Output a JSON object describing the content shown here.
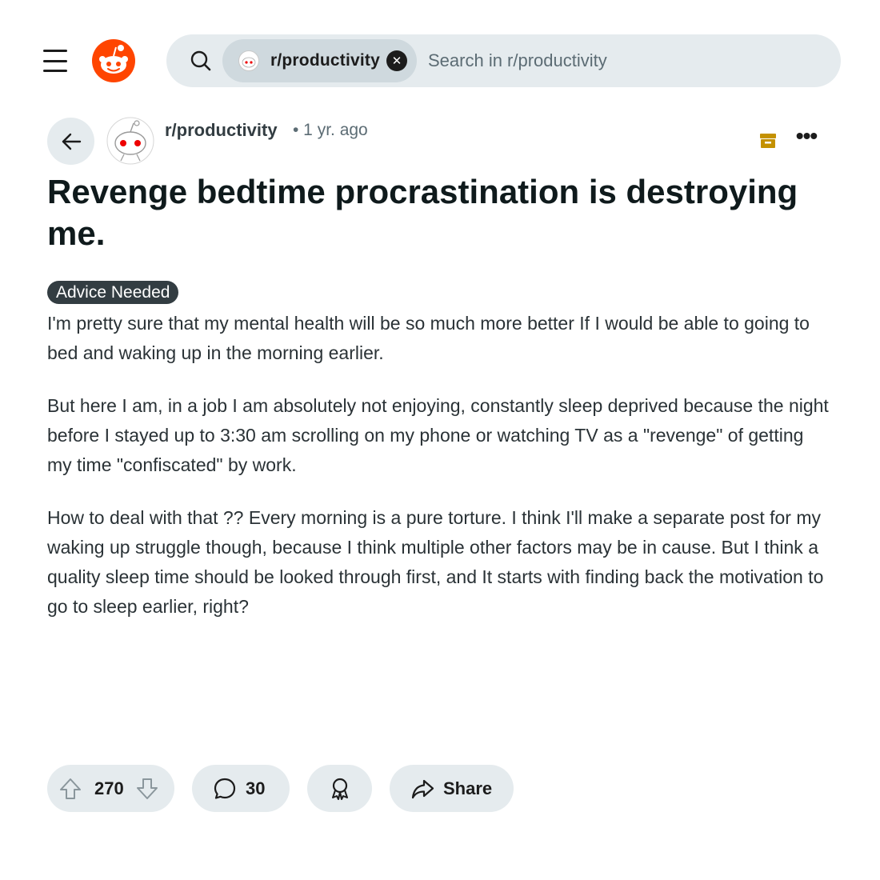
{
  "header": {
    "search": {
      "community_chip": "r/productivity",
      "placeholder": "Search in r/productivity"
    }
  },
  "post": {
    "subreddit": "r/productivity",
    "time": "• 1 yr. ago",
    "title": "Revenge bedtime procrastination is destroying me.",
    "flair": "Advice Needed",
    "body": [
      "I'm pretty sure that my mental health will be so much more better If I would be able to going to bed and waking up in the morning earlier.",
      "But here I am, in a job I am absolutely not enjoying, constantly sleep deprived because the night before I stayed up to 3:30 am scrolling on my phone or watching TV as a \"revenge\" of getting my time \"confiscated\" by work.",
      "How to deal with that ?? Every morning is a pure torture. I think I'll make a separate post for my waking up struggle though, because I think multiple other factors may be in cause. But I think a quality sleep time should be looked through first, and It starts with finding back the motivation to go to sleep earlier, right?"
    ]
  },
  "actions": {
    "votes": "270",
    "comments": "30",
    "share_label": "Share"
  },
  "colors": {
    "brand": "#ff4500",
    "chip_bg": "#cfd9de",
    "button_bg": "#e5ebee",
    "archive": "#c49100"
  },
  "icons": [
    "menu-icon",
    "reddit-logo",
    "search-icon",
    "close-icon",
    "back-arrow-icon",
    "archive-icon",
    "more-icon",
    "upvote-icon",
    "downvote-icon",
    "comment-icon",
    "award-icon",
    "share-icon"
  ]
}
